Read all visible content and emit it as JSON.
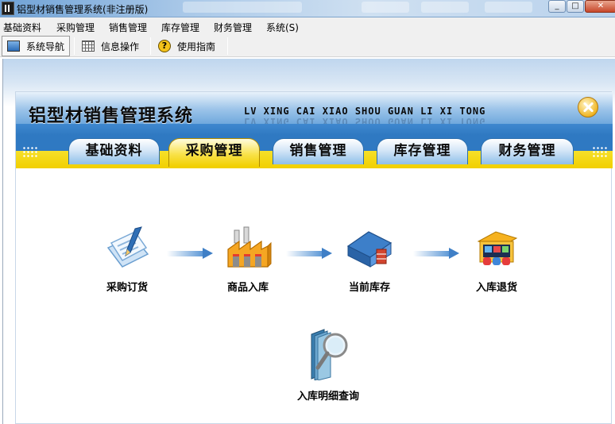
{
  "window": {
    "title": "铝型材销售管理系统(非注册版)"
  },
  "menubar": {
    "items": [
      "基础资料",
      "采购管理",
      "销售管理",
      "库存管理",
      "财务管理",
      "系统(S)"
    ]
  },
  "toolbar": {
    "items": [
      {
        "label": "系统导航",
        "icon": "monitor-icon",
        "active": true
      },
      {
        "label": "信息操作",
        "icon": "grid-icon",
        "active": false
      },
      {
        "label": "使用指南",
        "icon": "help-icon",
        "active": false
      }
    ]
  },
  "panel": {
    "title": "铝型材销售管理系统",
    "pinyin": "LV XING CAI XIAO SHOU GUAN LI XI TONG",
    "tabs": [
      "基础资料",
      "采购管理",
      "销售管理",
      "库存管理",
      "财务管理"
    ],
    "active_tab": "采购管理",
    "flow": [
      {
        "label": "采购订货",
        "icon": "purchase-order-icon"
      },
      {
        "label": "商品入库",
        "icon": "factory-icon"
      },
      {
        "label": "当前库存",
        "icon": "warehouse-icon"
      },
      {
        "label": "入库退货",
        "icon": "shop-return-icon"
      }
    ],
    "query": {
      "label": "入库明细查询",
      "icon": "magnifier-folder-icon"
    }
  },
  "colors": {
    "header_blue": "#2f79c2",
    "tab_yellow": "#f1cf00",
    "arrow_blue": "#3f7fc6"
  }
}
